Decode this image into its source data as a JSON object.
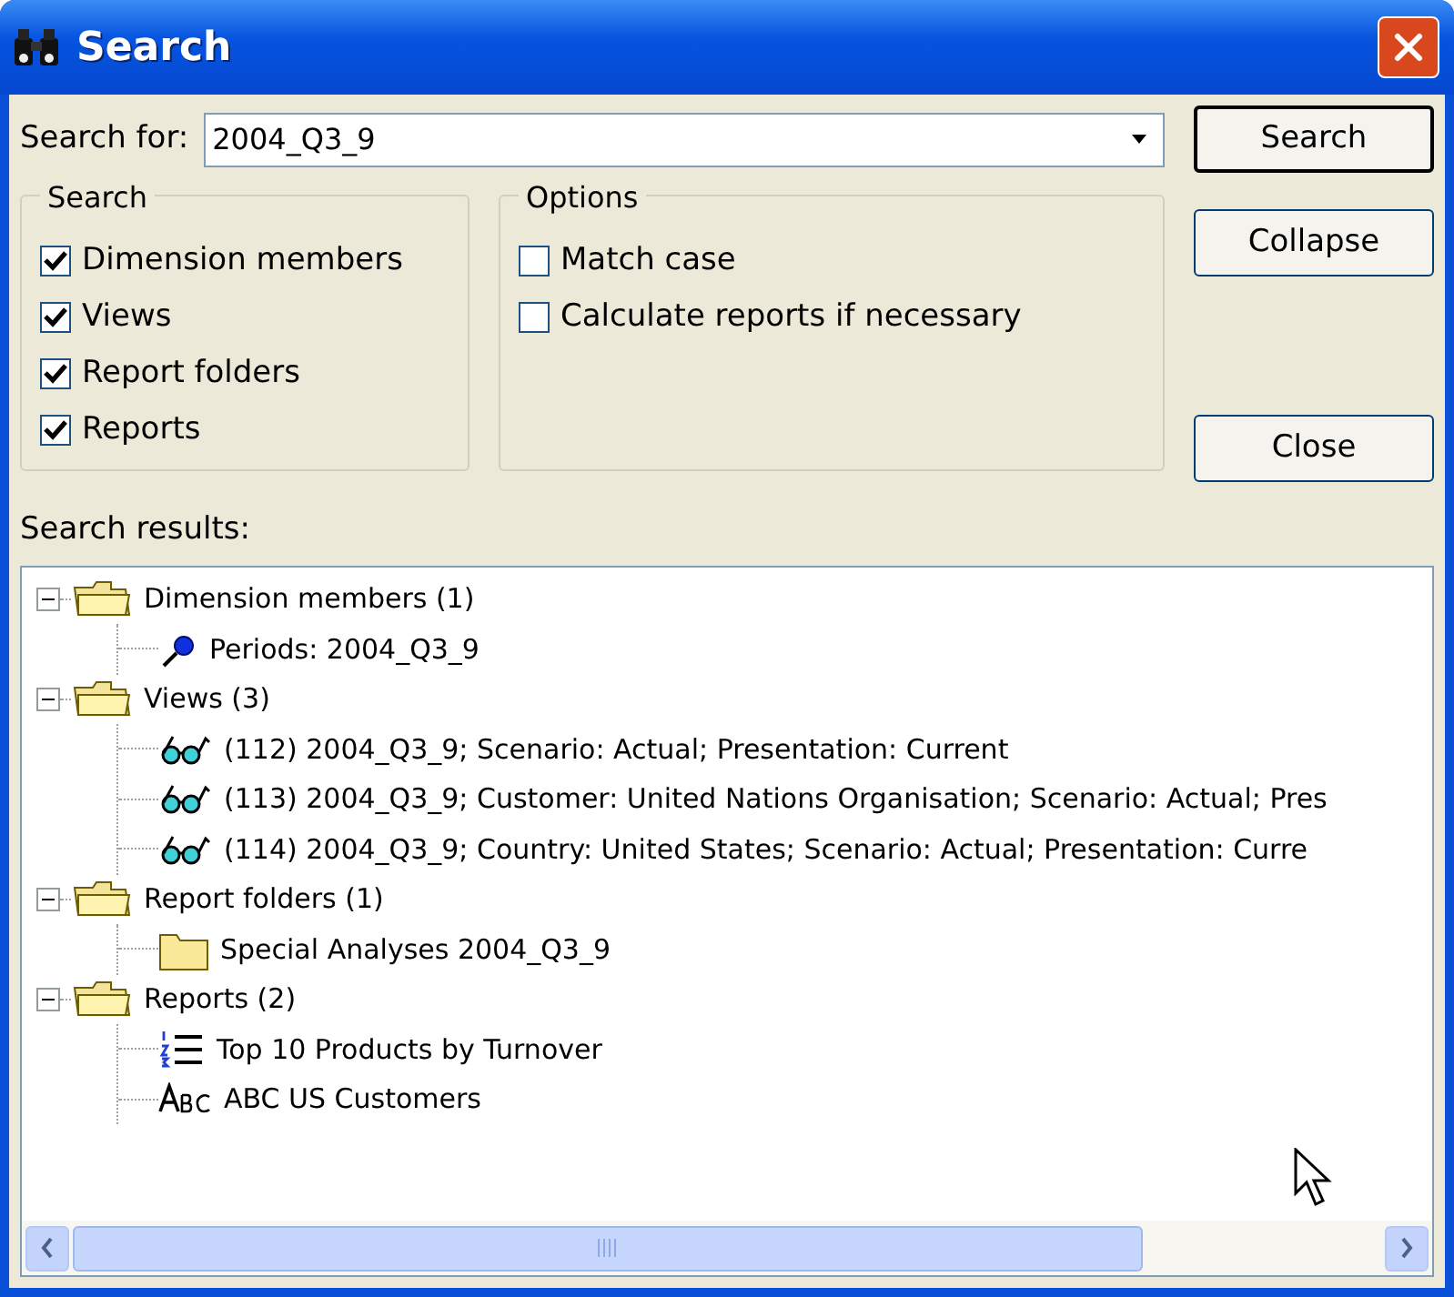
{
  "window": {
    "title": "Search"
  },
  "search_for": {
    "label": "Search for:",
    "value": "2004_Q3_9"
  },
  "groups": [
    {
      "title": "Search",
      "options": [
        {
          "label": "Dimension members",
          "checked": true
        },
        {
          "label": "Views",
          "checked": true
        },
        {
          "label": "Report folders",
          "checked": true
        },
        {
          "label": "Reports",
          "checked": true
        }
      ]
    },
    {
      "title": "Options",
      "options": [
        {
          "label": "Match case",
          "checked": false
        },
        {
          "label": "Calculate reports if necessary",
          "checked": false
        }
      ]
    }
  ],
  "buttons": [
    {
      "label": "Search",
      "default": true
    },
    {
      "label": "Collapse",
      "default": false
    },
    {
      "label": "Close",
      "default": false
    }
  ],
  "results": {
    "label": "Search results:",
    "tree": [
      {
        "kind": "folder",
        "label": "Dimension members (1)",
        "expanded": true,
        "children": [
          {
            "kind": "member",
            "label": "Periods: 2004_Q3_9"
          }
        ]
      },
      {
        "kind": "folder",
        "label": "Views (3)",
        "expanded": true,
        "children": [
          {
            "kind": "view",
            "label": "(112) 2004_Q3_9; Scenario: Actual; Presentation: Current"
          },
          {
            "kind": "view",
            "label": "(113) 2004_Q3_9; Customer: United Nations Organisation; Scenario: Actual; Pres"
          },
          {
            "kind": "view",
            "label": "(114) 2004_Q3_9; Country: United States; Scenario: Actual; Presentation: Curre"
          }
        ]
      },
      {
        "kind": "folder",
        "label": "Report folders (1)",
        "expanded": true,
        "children": [
          {
            "kind": "report-folder",
            "label": "Special Analyses 2004_Q3_9"
          }
        ]
      },
      {
        "kind": "folder",
        "label": "Reports (2)",
        "expanded": true,
        "children": [
          {
            "kind": "list-report",
            "label": "Top 10 Products by Turnover"
          },
          {
            "kind": "text-report",
            "label": "ABC US Customers"
          }
        ]
      }
    ]
  }
}
